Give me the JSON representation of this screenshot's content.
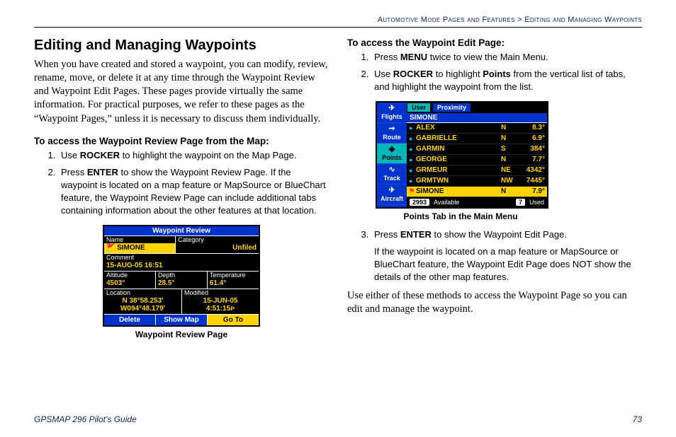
{
  "breadcrumb": {
    "section": "Automotive Mode Pages and Features",
    "sep": " > ",
    "topic": "Editing and Managing Waypoints"
  },
  "left": {
    "heading": "Editing and Managing Waypoints",
    "intro": "When you have created and stored a waypoint, you can modify, review, rename, move, or delete it at any time through the Waypoint Review and Waypoint Edit Pages. These pages provide virtually the same information. For practical purposes, we refer to these pages as the “Waypoint Pages,” unless it is necessary to discuss them individually.",
    "proc_heading": "To access the Waypoint Review Page from the Map:",
    "step1_a": "Use ",
    "step1_kw": "ROCKER",
    "step1_b": " to highlight the waypoint on the Map Page.",
    "step2_a": "Press ",
    "step2_kw": "ENTER",
    "step2_b": " to show the Waypoint Review Page. If the waypoint is located on a map feature or MapSource or BlueChart feature, the Waypoint Review Page can include additional tabs containing information about the other features at that location.",
    "caption": "Waypoint Review Page"
  },
  "wr": {
    "title": "Waypoint Review",
    "name_label": "Name",
    "name_value": "SIMONE",
    "cat_label": "Category",
    "cat_value": "Unfiled",
    "comment_label": "Comment",
    "comment_value": "15-AUG-05 16:51",
    "alt_label": "Altitude",
    "alt_value": "4503°",
    "depth_label": "Depth",
    "depth_value": "28.5°",
    "temp_label": "Temperature",
    "temp_value": "61.4°",
    "loc_label": "Location",
    "loc_value1": "N  38°58.253'",
    "loc_value2": "W094°48.179'",
    "mod_label": "Modified",
    "mod_value1": "15-JUN-05",
    "mod_value2": "4:51:15ᴘ",
    "btn_delete": "Delete",
    "btn_showmap": "Show Map",
    "btn_goto": "Go To"
  },
  "right": {
    "proc_heading": "To access the Waypoint Edit Page:",
    "step1_a": "Press ",
    "step1_kw": "MENU",
    "step1_b": " twice to view the Main Menu.",
    "step2_a": "Use ",
    "step2_kw1": "ROCKER",
    "step2_b": " to highlight ",
    "step2_kw2": "Points",
    "step2_c": " from the vertical list of tabs, and highlight the waypoint from the list.",
    "caption": "Points Tab in the Main Menu",
    "step3_a": "Press ",
    "step3_kw": "ENTER",
    "step3_b": " to show the Waypoint Edit Page.",
    "step3_para": "If the waypoint is located on a map feature or MapSource or BlueChart feature, the Waypoint Edit Page does NOT show the details of the other map features.",
    "closing": "Use either of these methods to access the Waypoint Page so you can edit and manage the waypoint."
  },
  "pt": {
    "side": [
      {
        "label": "Flights",
        "icon": "✈"
      },
      {
        "label": "Route",
        "icon": "➞"
      },
      {
        "label": "Points",
        "icon": "◈"
      },
      {
        "label": "Track",
        "icon": "∿"
      },
      {
        "label": "Aircraft",
        "icon": "✈"
      }
    ],
    "toptabs": {
      "user": "User",
      "prox": "Proximity"
    },
    "header": "SIMONE",
    "rows": [
      {
        "name": "ALEX",
        "dir": "N",
        "dist": "8.3°",
        "sel": false,
        "red": false
      },
      {
        "name": "GABRIELLE",
        "dir": "N",
        "dist": "6.9°",
        "sel": false,
        "red": false
      },
      {
        "name": "GARMIN",
        "dir": "S",
        "dist": "384°",
        "sel": false,
        "red": false
      },
      {
        "name": "GEORGE",
        "dir": "N",
        "dist": "7.7°",
        "sel": false,
        "red": false
      },
      {
        "name": "GRMEUR",
        "dir": "NE",
        "dist": "4342°",
        "sel": false,
        "red": false
      },
      {
        "name": "GRMTWN",
        "dir": "NW",
        "dist": "7445°",
        "sel": false,
        "red": false
      },
      {
        "name": "SIMONE",
        "dir": "N",
        "dist": "7.9°",
        "sel": true,
        "red": true
      }
    ],
    "avail_count": "2993",
    "avail_label": "Available",
    "used_count": "7",
    "used_label": "Used"
  },
  "footer": {
    "left": "GPSMAP 296 Pilot’s Guide",
    "right": "73"
  }
}
